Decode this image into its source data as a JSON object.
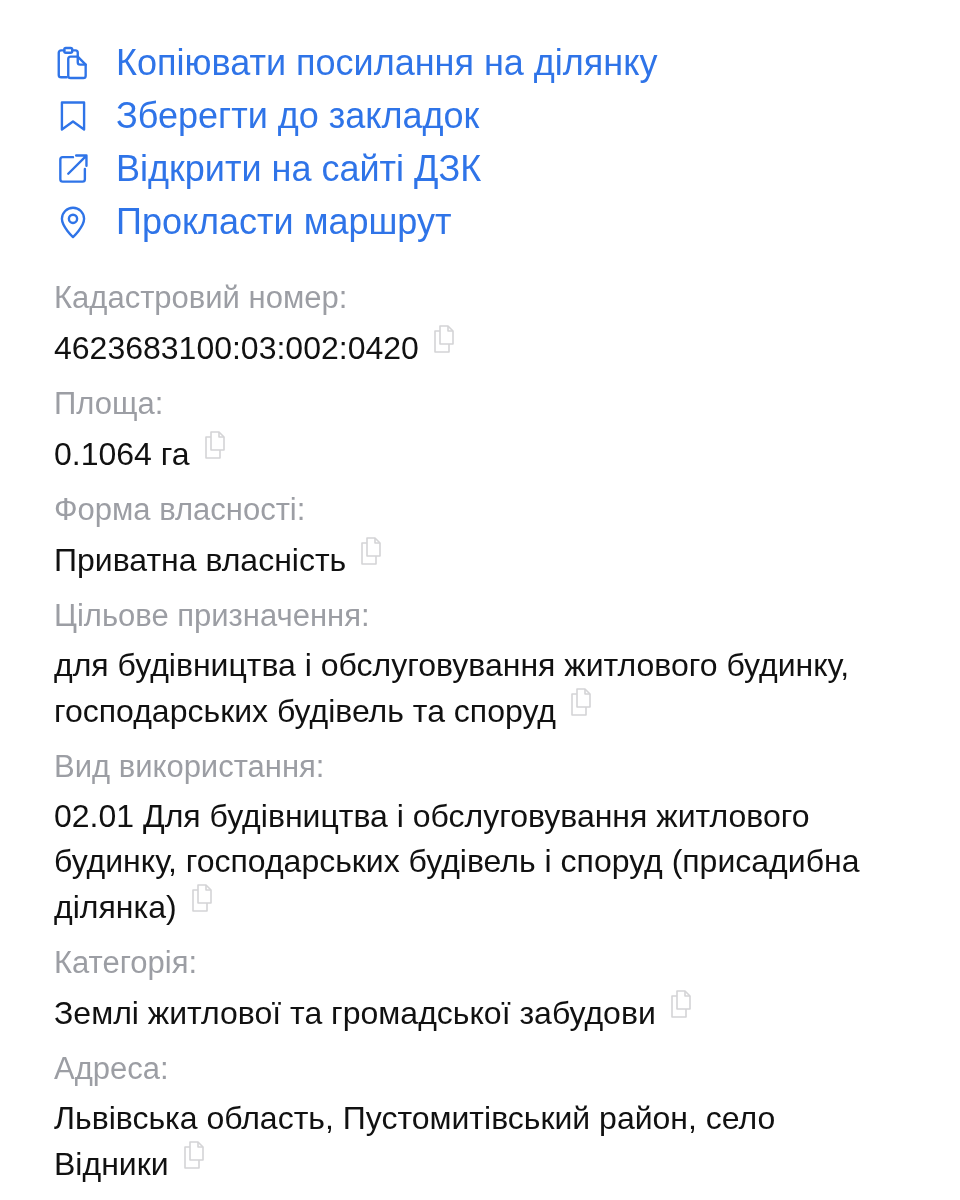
{
  "actions": [
    {
      "kind": "copy_link",
      "label": "Копіювати посилання на ділянку"
    },
    {
      "kind": "bookmark",
      "label": "Зберегти до закладок"
    },
    {
      "kind": "open_external",
      "label": "Відкрити на сайті ДЗК"
    },
    {
      "kind": "route",
      "label": "Прокласти маршрут"
    }
  ],
  "fields": [
    {
      "label": "Кадастровий номер:",
      "value": "4623683100:03:002:0420"
    },
    {
      "label": "Площа:",
      "value": "0.1064 га"
    },
    {
      "label": "Форма власності:",
      "value": "Приватна власність"
    },
    {
      "label": "Цільове призначення:",
      "value": "для будівництва і обслуговування житлового будинку, господарських будівель та споруд"
    },
    {
      "label": "Вид використання:",
      "value": "02.01 Для будівництва і обслуговування житлового будинку, господарських будівель і споруд (присадибна ділянка)"
    },
    {
      "label": "Категорія:",
      "value": "Землі житлової та громадської забудови"
    },
    {
      "label": "Адреса:",
      "value": "Львівська область, Пустомитівський район, село Відники"
    }
  ]
}
